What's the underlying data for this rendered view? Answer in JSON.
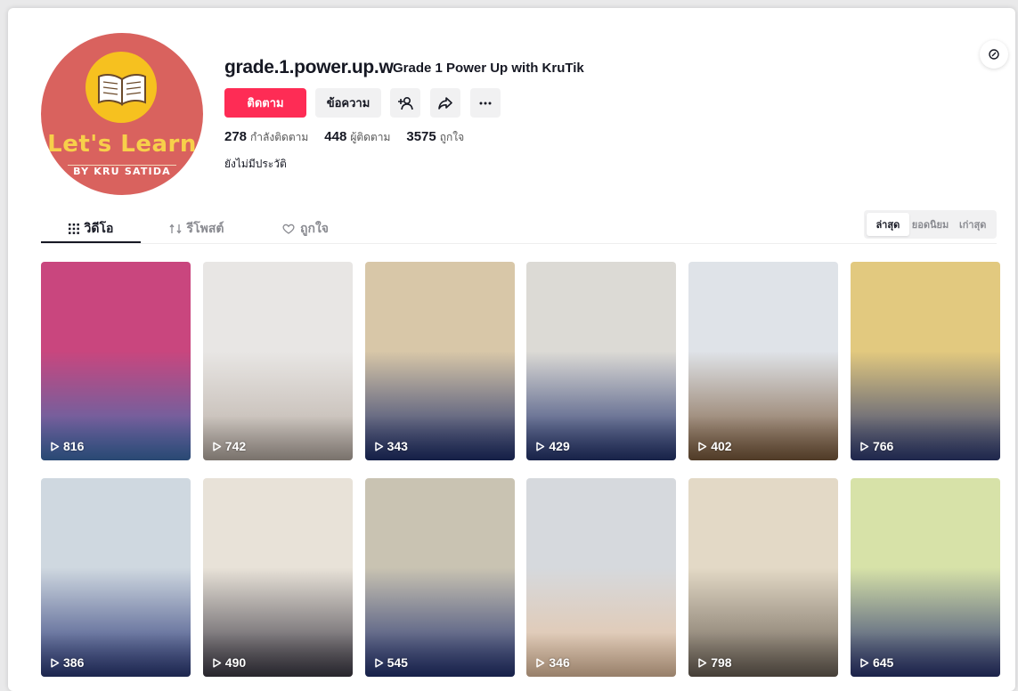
{
  "profile": {
    "username": "grade.1.power.up.w",
    "nickname": "Grade 1 Power Up with KruTik",
    "avatar_title": "Let's Learn",
    "avatar_subtitle": "BY KRU SATIDA",
    "follow_label": "ติดตาม",
    "message_label": "ข้อความ",
    "following_count": "278",
    "following_label": "กำลังติดตาม",
    "followers_count": "448",
    "followers_label": "ผู้ติดตาม",
    "likes_count": "3575",
    "likes_label": "ถูกใจ",
    "bio": "ยังไม่มีประวัติ"
  },
  "tabs": [
    {
      "label": "วิดีโอ",
      "icon": "grid-icon"
    },
    {
      "label": "รีโพสต์",
      "icon": "repost-icon"
    },
    {
      "label": "ถูกใจ",
      "icon": "heart-icon"
    }
  ],
  "sort": [
    "ล่าสุด",
    "ยอดนิยม",
    "เก่าสุด"
  ],
  "videos": [
    {
      "views": "816",
      "colors": [
        "#c9467e",
        "#3f6fb0"
      ]
    },
    {
      "views": "742",
      "colors": [
        "#e8e6e4",
        "#b9aea5"
      ]
    },
    {
      "views": "343",
      "colors": [
        "#d8c7a8",
        "#1f2f6b"
      ]
    },
    {
      "views": "429",
      "colors": [
        "#dcdad5",
        "#24346e"
      ]
    },
    {
      "views": "402",
      "colors": [
        "#dfe3e8",
        "#7a5a3c"
      ]
    },
    {
      "views": "766",
      "colors": [
        "#e2c97f",
        "#2e3b74"
      ]
    },
    {
      "views": "386",
      "colors": [
        "#cfd8e0",
        "#2c3a78"
      ]
    },
    {
      "views": "490",
      "colors": [
        "#e8e2d8",
        "#3d3a45"
      ]
    },
    {
      "views": "545",
      "colors": [
        "#c9c3b2",
        "#233270"
      ]
    },
    {
      "views": "346",
      "colors": [
        "#d6d9dd",
        "#e7c3a2"
      ]
    },
    {
      "views": "798",
      "colors": [
        "#e3d9c6",
        "#6a6055"
      ]
    },
    {
      "views": "645",
      "colors": [
        "#d7e2a8",
        "#2a3471"
      ]
    }
  ]
}
